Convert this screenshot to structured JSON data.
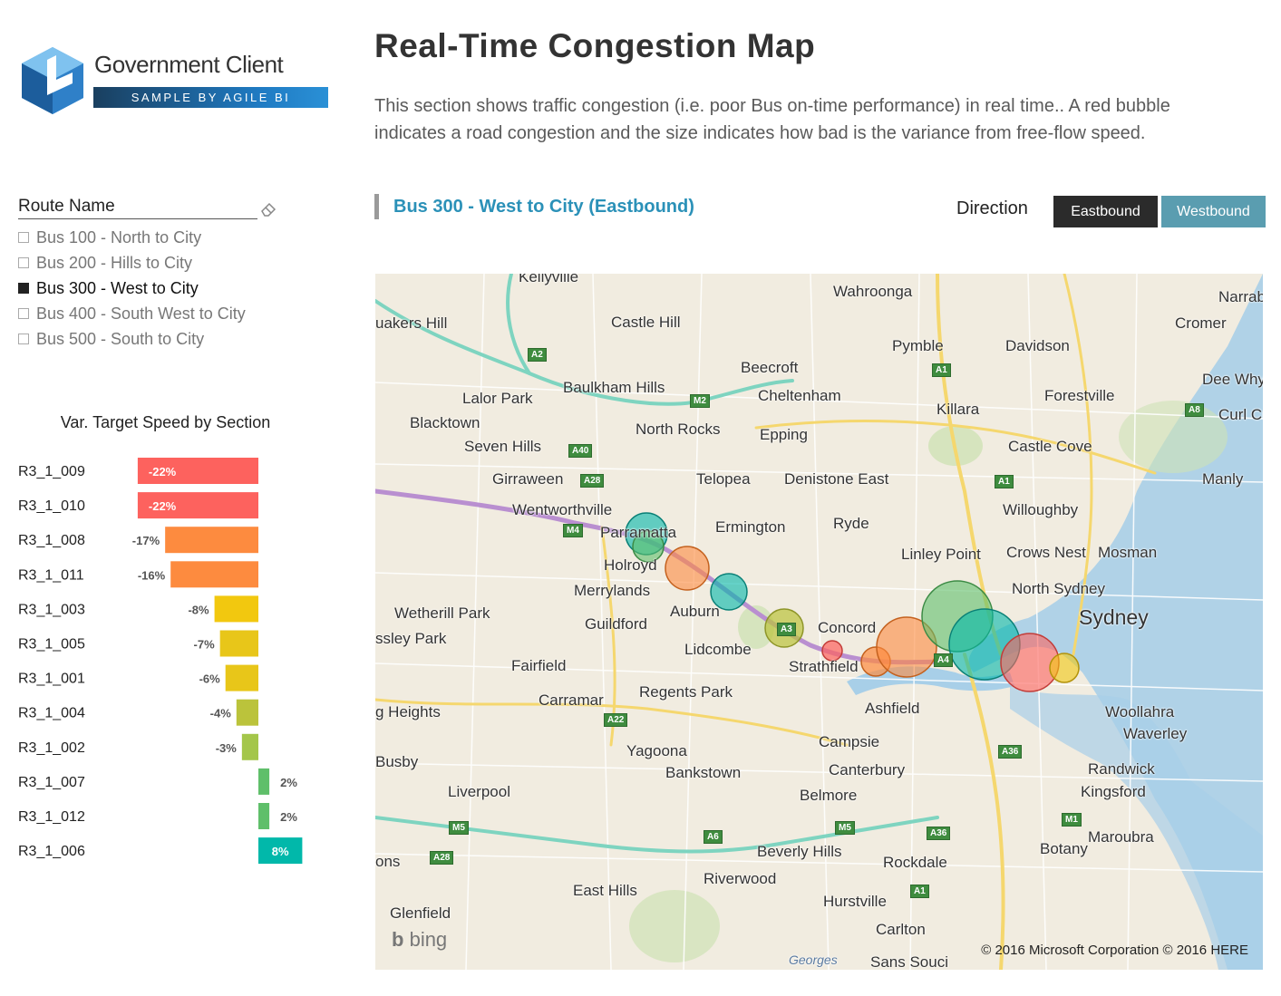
{
  "logo": {
    "name": "Government Client",
    "tagline": "SAMPLE BY AGILE BI"
  },
  "page": {
    "title": "Real-Time Congestion Map",
    "description": "This section shows traffic congestion (i.e. poor Bus on-time performance) in real time.. A red bubble indicates a road congestion and the size indicates how bad is the variance from free-flow speed."
  },
  "slicer": {
    "title": "Route Name",
    "items": [
      {
        "label": "Bus 100 - North to City",
        "selected": false
      },
      {
        "label": "Bus 200 - Hills to City",
        "selected": false
      },
      {
        "label": "Bus 300 - West to City",
        "selected": true
      },
      {
        "label": "Bus 400 - South West to City",
        "selected": false
      },
      {
        "label": "Bus 500 - South to City",
        "selected": false
      }
    ]
  },
  "route": {
    "title": "Bus 300 - West to City (Eastbound)"
  },
  "direction": {
    "label": "Direction",
    "east": "Eastbound",
    "west": "Westbound",
    "active": "Eastbound"
  },
  "chart_data": {
    "type": "bar",
    "title": "Var. Target Speed by Section",
    "categories": [
      "R3_1_009",
      "R3_1_010",
      "R3_1_008",
      "R3_1_011",
      "R3_1_003",
      "R3_1_005",
      "R3_1_001",
      "R3_1_004",
      "R3_1_002",
      "R3_1_007",
      "R3_1_012",
      "R3_1_006"
    ],
    "values": [
      -22,
      -22,
      -17,
      -16,
      -8,
      -7,
      -6,
      -4,
      -3,
      2,
      2,
      8
    ],
    "labels": [
      "-22%",
      "-22%",
      "-17%",
      "-16%",
      "-8%",
      "-7%",
      "-6%",
      "-4%",
      "-3%",
      "2%",
      "2%",
      "8%"
    ],
    "colors": [
      "#fd625e",
      "#fd625e",
      "#fd8b3f",
      "#fd8b3f",
      "#f2c80f",
      "#e8c619",
      "#e8c619",
      "#bbc33b",
      "#a4c64a",
      "#5fbf6a",
      "#5fbf6a",
      "#01b8aa"
    ]
  },
  "map": {
    "labels": [
      {
        "text": "Kellyville"
      },
      {
        "text": "Wahroonga"
      },
      {
        "text": "Narrab"
      },
      {
        "text": "uakers Hill"
      },
      {
        "text": "Castle Hill"
      },
      {
        "text": "Pymble"
      },
      {
        "text": "Davidson"
      },
      {
        "text": "Cromer"
      },
      {
        "text": "Beecroft"
      },
      {
        "text": "Dee Why"
      },
      {
        "text": "Baulkham Hills"
      },
      {
        "text": "Cheltenham"
      },
      {
        "text": "Forestville"
      },
      {
        "text": "Lalor Park"
      },
      {
        "text": "Killara"
      },
      {
        "text": "Curl Cu"
      },
      {
        "text": "Blacktown"
      },
      {
        "text": "North Rocks"
      },
      {
        "text": "Epping"
      },
      {
        "text": "Seven Hills"
      },
      {
        "text": "Castle Cove"
      },
      {
        "text": "Girraween"
      },
      {
        "text": "Telopea"
      },
      {
        "text": "Denistone East"
      },
      {
        "text": "Manly"
      },
      {
        "text": "Wentworthville"
      },
      {
        "text": "Willoughby"
      },
      {
        "text": "Parramatta"
      },
      {
        "text": "Ermington"
      },
      {
        "text": "Ryde"
      },
      {
        "text": "Linley Point"
      },
      {
        "text": "Crows Nest"
      },
      {
        "text": "Mosman"
      },
      {
        "text": "Holroyd"
      },
      {
        "text": "Merrylands"
      },
      {
        "text": "North Sydney"
      },
      {
        "text": "Auburn"
      },
      {
        "text": "Sydney"
      },
      {
        "text": "Wetherill Park"
      },
      {
        "text": "Guildford"
      },
      {
        "text": "Concord"
      },
      {
        "text": "ssley Park"
      },
      {
        "text": "Lidcombe"
      },
      {
        "text": "Fairfield"
      },
      {
        "text": "Strathfield"
      },
      {
        "text": "Carramar"
      },
      {
        "text": "Regents Park"
      },
      {
        "text": "Ashfield"
      },
      {
        "text": "Woollahra"
      },
      {
        "text": "g Heights"
      },
      {
        "text": "Waverley"
      },
      {
        "text": "Campsie"
      },
      {
        "text": "Busby"
      },
      {
        "text": "Yagoona"
      },
      {
        "text": "Canterbury"
      },
      {
        "text": "Randwick"
      },
      {
        "text": "Bankstown"
      },
      {
        "text": "Liverpool"
      },
      {
        "text": "Belmore"
      },
      {
        "text": "Kingsford"
      },
      {
        "text": "Maroubra"
      },
      {
        "text": "Botany"
      },
      {
        "text": "Beverly Hills"
      },
      {
        "text": "ons"
      },
      {
        "text": "Rockdale"
      },
      {
        "text": "Riverwood"
      },
      {
        "text": "East Hills"
      },
      {
        "text": "Hurstville"
      },
      {
        "text": "Glenfield"
      },
      {
        "text": "Carlton"
      },
      {
        "text": "Sans Souci"
      },
      {
        "text": "Georges"
      }
    ],
    "shields": [
      "A2",
      "M2",
      "A1",
      "A40",
      "A28",
      "A8",
      "A1",
      "M4",
      "A3",
      "A4",
      "A22",
      "A36",
      "M5",
      "A6",
      "M5",
      "A36",
      "M1",
      "A28",
      "A1"
    ],
    "attribution": "bing",
    "copyright": "© 2016 Microsoft Corporation   © 2016 HERE"
  }
}
